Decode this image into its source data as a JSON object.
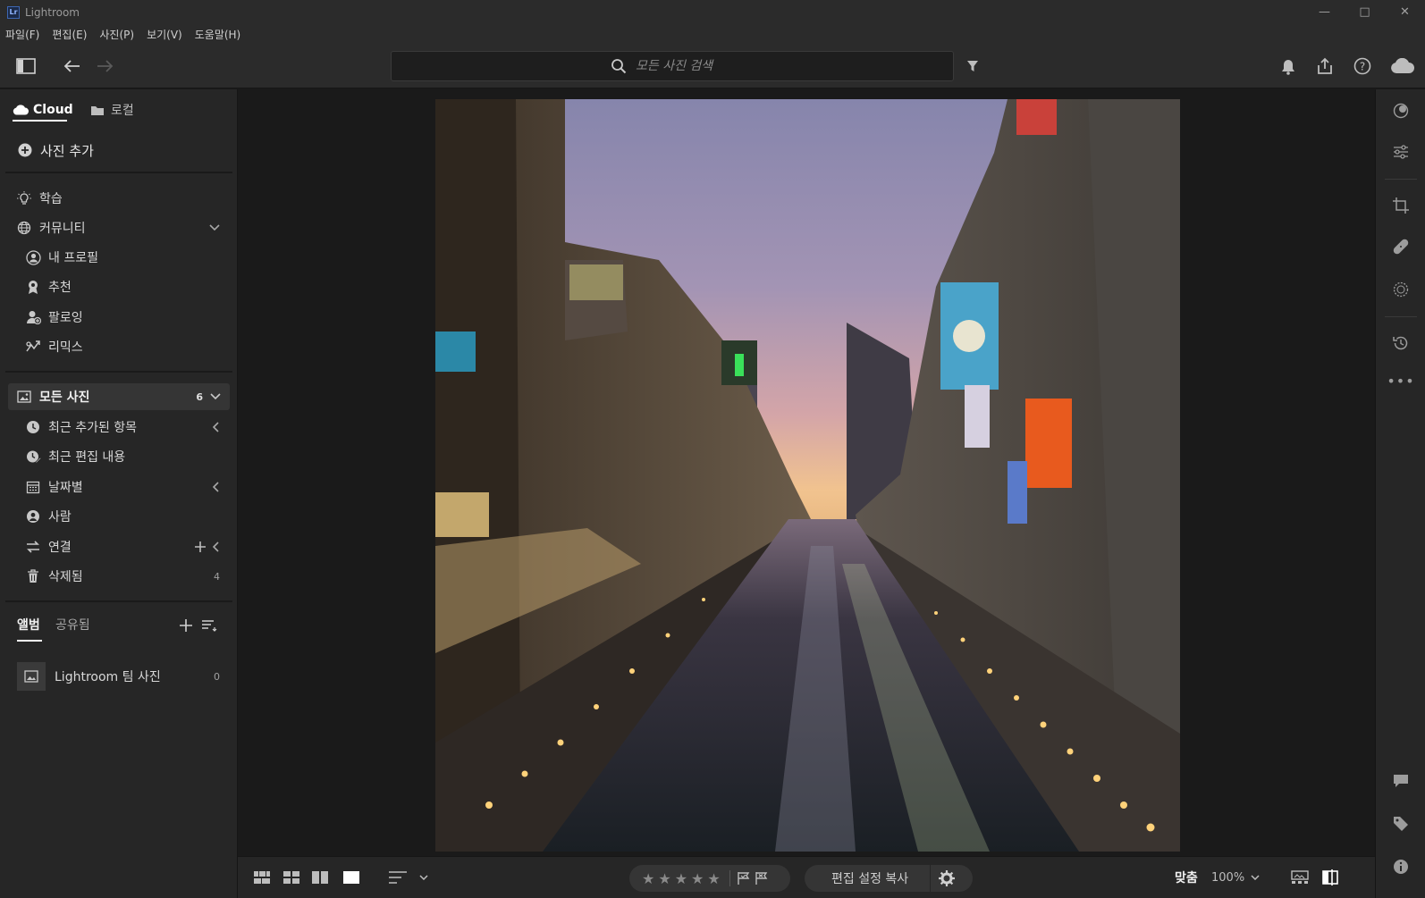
{
  "window": {
    "title": "Lightroom",
    "logo_text": "Lr"
  },
  "menu": [
    "파일(F)",
    "편집(E)",
    "사진(P)",
    "보기(V)",
    "도움말(H)"
  ],
  "search": {
    "placeholder": "모든 사진 검색"
  },
  "sidebar": {
    "tabs": {
      "cloud": "Cloud",
      "local": "로컬"
    },
    "add_photos": "사진 추가",
    "learn": "학습",
    "community": "커뮤니티",
    "community_items": [
      "내 프로필",
      "추천",
      "팔로잉",
      "리믹스"
    ],
    "all_photos": {
      "label": "모든 사진",
      "count": "6"
    },
    "library_items": [
      {
        "label": "최근 추가된 항목"
      },
      {
        "label": "최근 편집 내용"
      },
      {
        "label": "날짜별"
      },
      {
        "label": "사람"
      },
      {
        "label": "연결"
      },
      {
        "label": "삭제됨",
        "count": "4"
      }
    ],
    "album_tabs": {
      "albums": "앨범",
      "shared": "공유됨"
    },
    "albums": [
      {
        "label": "Lightroom 팀 사진",
        "count": "0"
      }
    ]
  },
  "bottombar": {
    "copy_edits": "편집 설정 복사",
    "fit": "맞춤",
    "zoom": "100%",
    "stars": [
      "★",
      "★",
      "★",
      "★",
      "★"
    ]
  },
  "colors": {
    "accent": "#ffffff",
    "panel": "#262626",
    "bg": "#1a1a1a"
  }
}
